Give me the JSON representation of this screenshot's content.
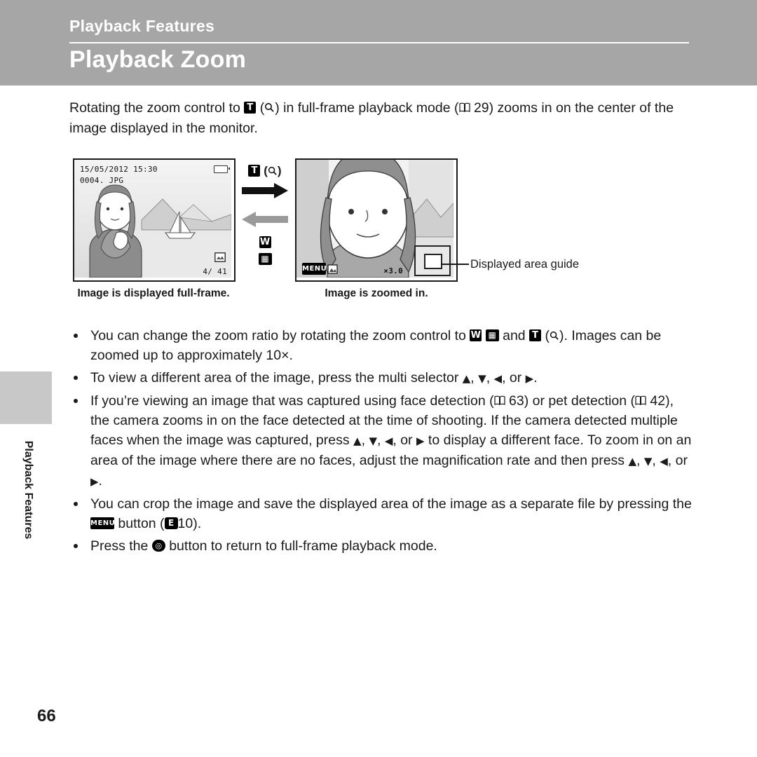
{
  "header": {
    "chapter": "Playback Features",
    "title": "Playback Zoom"
  },
  "side_tab": {
    "label": "Playback Features"
  },
  "intro": {
    "part1": "Rotating the zoom control to ",
    "icon_t": "T",
    "icon_t_magnify": "Q",
    "part2": " in full-frame playback mode (",
    "ref_page": "29",
    "part3": ") zooms in on the center of the image displayed in the monitor."
  },
  "figure": {
    "lcd1": {
      "date": "15/05/2012  15:30",
      "filename": "0004. JPG",
      "counter": "4/  41",
      "icon_label": "retouch-icon"
    },
    "lcd2": {
      "menu_label": "MENU",
      "zoom_ratio": "×3.0"
    },
    "zoom_in_label": "T",
    "zoom_in_icon": "magnify-plus-icon",
    "zoom_out_label": "W",
    "zoom_out_icon": "thumbnail-icon",
    "caption_left": "Image is displayed full-frame.",
    "caption_right": "Image is zoomed in.",
    "guide_label": "Displayed area guide"
  },
  "bullets": [
    {
      "id": "bullet-zoom-ratio",
      "segments": [
        {
          "type": "text",
          "value": "You can change the zoom ratio by rotating the zoom control to "
        },
        {
          "type": "icon",
          "value": "W"
        },
        {
          "type": "icon_sq",
          "value": "▦"
        },
        {
          "type": "text",
          "value": " and "
        },
        {
          "type": "icon",
          "value": "T"
        },
        {
          "type": "icon_sq",
          "value": "Q"
        },
        {
          "type": "text",
          "value": ". Images can be zoomed up to approximately 10×."
        }
      ],
      "plain": "You can change the zoom ratio by rotating the zoom control to W and T. Images can be zoomed up to approximately 10×."
    },
    {
      "id": "bullet-multi-selector",
      "plain": "To view a different area of the image, press the multi selector H, I, J, or K."
    },
    {
      "id": "bullet-face-detection",
      "plain": "If you’re viewing an image that was captured using face detection (A 63) or pet detection (A 42), the camera zooms in on the face detected at the time of shooting. If the camera detected multiple faces when the image was captured, press H, I, J, or K to display a different face. To zoom in on an area of the image where there are no faces, adjust the magnification rate and then press H, I, J, or K.",
      "ref_face": "63",
      "ref_pet": "42"
    },
    {
      "id": "bullet-crop",
      "plain": "You can crop the image and save the displayed area of the image as a separate file by pressing the MENU button (E10).",
      "ref_crop": "10"
    },
    {
      "id": "bullet-ok-button",
      "plain": "Press the k button to return to full-frame playback mode."
    }
  ],
  "page_number": "66",
  "colors": {
    "header_band": "#a6a6a6",
    "side_tab": "#c8c8c8",
    "text": "#1a1a1a"
  }
}
